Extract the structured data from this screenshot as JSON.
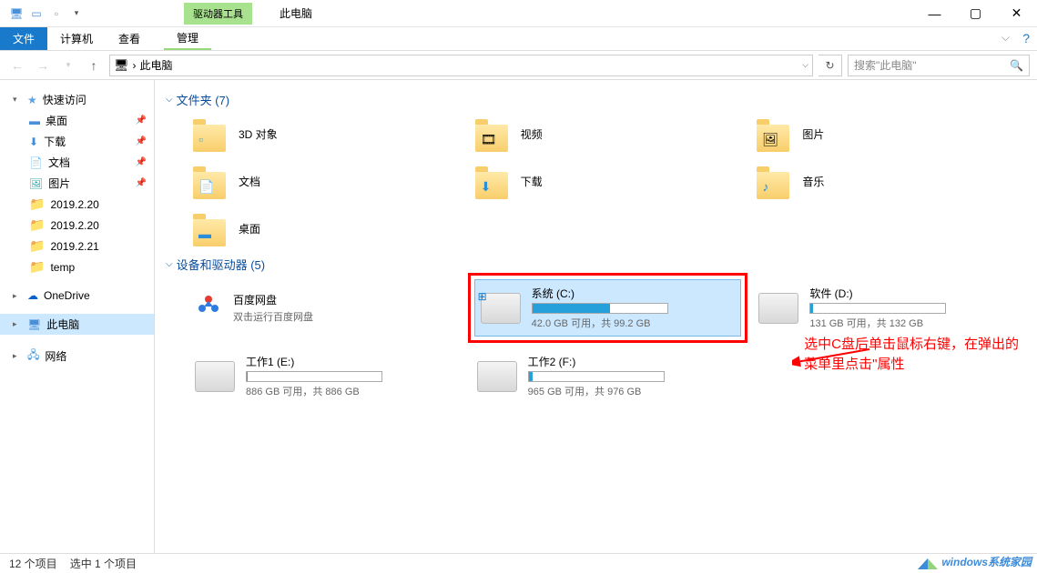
{
  "titlebar": {
    "drive_tool": "驱动器工具",
    "drive_tool_sub": "管理",
    "title": "此电脑"
  },
  "ribbon": {
    "file": "文件",
    "computer": "计算机",
    "view": "查看",
    "manage": "管理"
  },
  "address": {
    "location": "此电脑",
    "sep": "›"
  },
  "search": {
    "placeholder": "搜索\"此电脑\""
  },
  "sidebar": {
    "quick": "快速访问",
    "items": [
      {
        "label": "桌面",
        "pinned": true
      },
      {
        "label": "下载",
        "pinned": true
      },
      {
        "label": "文档",
        "pinned": true
      },
      {
        "label": "图片",
        "pinned": true
      },
      {
        "label": "2019.2.20"
      },
      {
        "label": "2019.2.20"
      },
      {
        "label": "2019.2.21"
      },
      {
        "label": "temp"
      }
    ],
    "onedrive": "OneDrive",
    "thispc": "此电脑",
    "network": "网络"
  },
  "groups": {
    "folders": "文件夹 (7)",
    "devices": "设备和驱动器 (5)"
  },
  "folders": [
    {
      "label": "3D 对象"
    },
    {
      "label": "视频"
    },
    {
      "label": "图片"
    },
    {
      "label": "文档"
    },
    {
      "label": "下载"
    },
    {
      "label": "音乐"
    },
    {
      "label": "桌面"
    }
  ],
  "drives": [
    {
      "name": "百度网盘",
      "sub": "双击运行百度网盘",
      "type": "baidu"
    },
    {
      "name": "系统 (C:)",
      "stat": "42.0 GB 可用，共 99.2 GB",
      "fill": 58,
      "selected": true
    },
    {
      "name": "软件 (D:)",
      "stat": "131 GB 可用，共 132 GB",
      "fill": 2
    },
    {
      "name": "工作1 (E:)",
      "stat": "886 GB 可用，共 886 GB",
      "fill": 1
    },
    {
      "name": "工作2 (F:)",
      "stat": "965 GB 可用，共 976 GB",
      "fill": 3
    }
  ],
  "annotation": {
    "line1": "选中C盘后单击鼠标右键，在弹出的",
    "line2": "菜单里点击\"属性"
  },
  "status": {
    "count": "12 个项目",
    "selected": "选中 1 个项目"
  },
  "watermark": "windows系统家园"
}
